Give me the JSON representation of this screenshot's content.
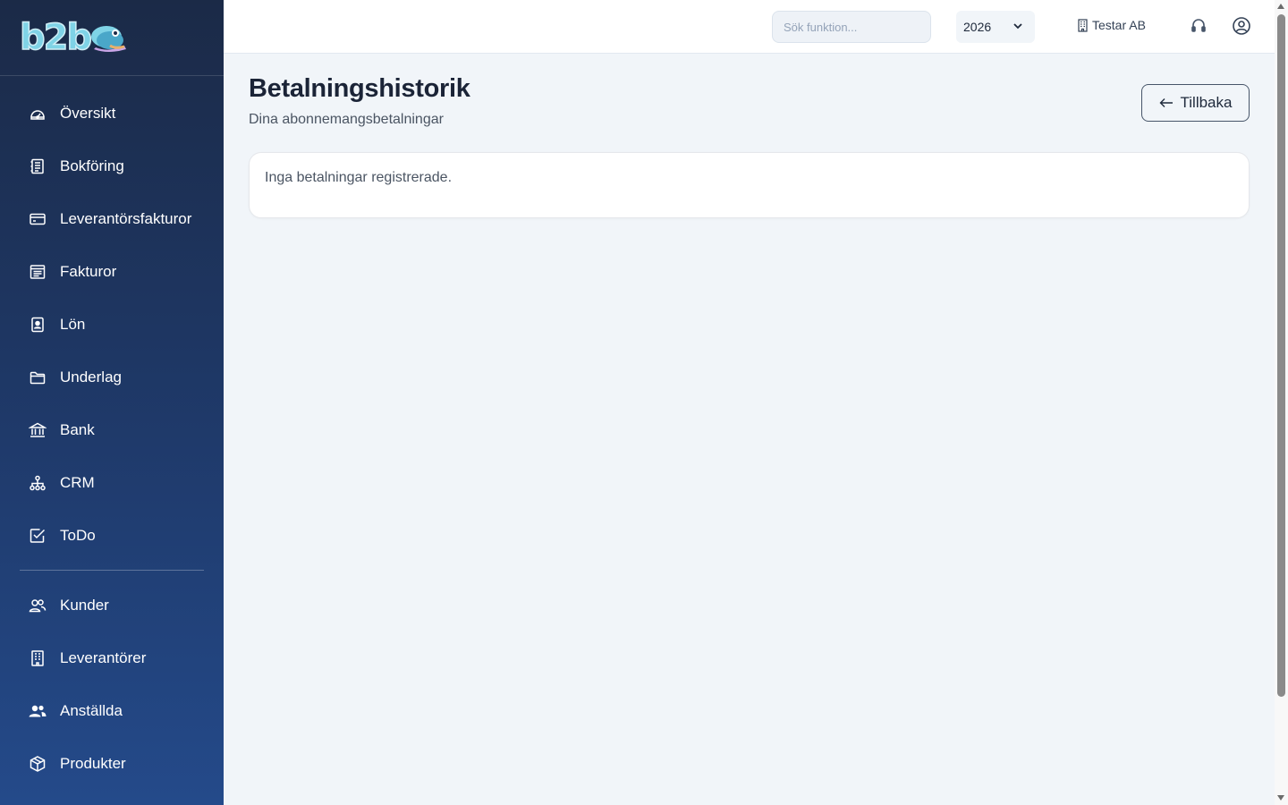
{
  "brand": {
    "logo_text": "b2b"
  },
  "sidebar": {
    "items": [
      {
        "label": "Översikt",
        "icon": "gauge-icon"
      },
      {
        "label": "Bokföring",
        "icon": "ledger-icon"
      },
      {
        "label": "Leverantörsfakturor",
        "icon": "credit-card-icon"
      },
      {
        "label": "Fakturor",
        "icon": "invoice-icon"
      },
      {
        "label": "Lön",
        "icon": "badge-icon"
      },
      {
        "label": "Underlag",
        "icon": "folder-icon"
      },
      {
        "label": "Bank",
        "icon": "bank-icon"
      },
      {
        "label": "CRM",
        "icon": "network-icon"
      },
      {
        "label": "ToDo",
        "icon": "checkbox-icon"
      }
    ],
    "secondary_items": [
      {
        "label": "Kunder",
        "icon": "users-outline-icon"
      },
      {
        "label": "Leverantörer",
        "icon": "building-icon"
      },
      {
        "label": "Anställda",
        "icon": "users-filled-icon"
      },
      {
        "label": "Produkter",
        "icon": "package-icon"
      }
    ]
  },
  "topbar": {
    "search_placeholder": "Sök funktion...",
    "year": "2026",
    "company": "Testar AB"
  },
  "page": {
    "title": "Betalningshistorik",
    "subtitle": "Dina abonnemangsbetalningar",
    "back_label": "Tillbaka",
    "empty_message": "Inga betalningar registrerade."
  }
}
